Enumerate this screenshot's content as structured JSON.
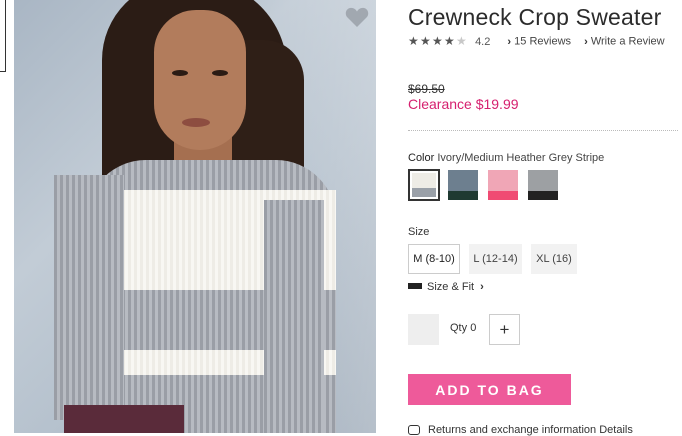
{
  "product": {
    "title": "Crewneck Crop Sweater",
    "rating_value": "4.2",
    "stars_filled": 4,
    "stars_total": 5,
    "reviews_link": "15 Reviews",
    "write_review_link": "Write a Review"
  },
  "pricing": {
    "original": "$69.50",
    "sale": "Clearance $19.99",
    "sale_color": "#d6206f"
  },
  "color": {
    "label": "Color",
    "selected_name": "Ivory/Medium Heather Grey Stripe",
    "swatches": [
      {
        "name": "ivory-grey",
        "top": "#eeece6",
        "bottom": "#9aa0a8",
        "selected": true
      },
      {
        "name": "slate-green",
        "top": "#6d7f8f",
        "bottom": "#1f3a32",
        "selected": false
      },
      {
        "name": "pink-coral",
        "top": "#f0a6b6",
        "bottom": "#f04b73",
        "selected": false
      },
      {
        "name": "grey-black",
        "top": "#9da0a3",
        "bottom": "#222222",
        "selected": false
      }
    ]
  },
  "size": {
    "label": "Size",
    "options": [
      "M (8-10)",
      "L (12-14)",
      "XL (16)"
    ],
    "selected": "M (8-10)",
    "size_fit_link": "Size & Fit"
  },
  "quantity": {
    "label": "Qty",
    "value": "0",
    "plus": "+"
  },
  "add_to_bag": {
    "label": "ADD TO BAG",
    "color": "#ee5a9a"
  },
  "footer": {
    "partial_text": "Returns and exchange information  Details"
  },
  "icons": {
    "heart": "heart-icon",
    "star": "star-icon",
    "chevron": "chevron-right-icon",
    "ruler": "ruler-icon",
    "chat": "chat-icon"
  }
}
